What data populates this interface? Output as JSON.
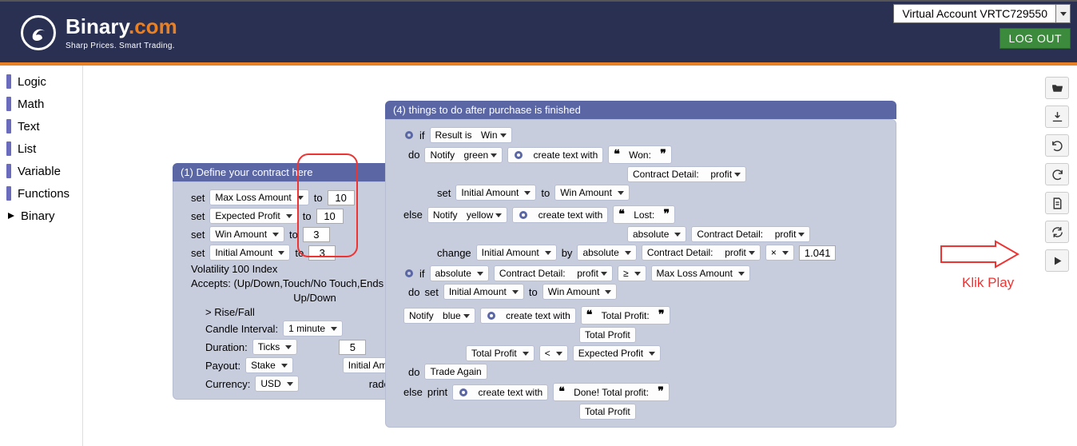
{
  "header": {
    "brand_main": "Binary",
    "brand_accent": ".com",
    "tagline": "Sharp Prices. Smart Trading.",
    "account": "Virtual Account VRTC729550",
    "logout": "LOG OUT"
  },
  "sidebar": {
    "items": [
      "Logic",
      "Math",
      "Text",
      "List",
      "Variable",
      "Functions",
      "Binary"
    ],
    "selected": "Binary"
  },
  "block1": {
    "title": "(1) Define your contract here",
    "set": "set",
    "to": "to",
    "vars": {
      "maxloss": "Max Loss Amount",
      "expected": "Expected Profit",
      "winamt": "Win Amount",
      "initamt": "Initial Amount"
    },
    "vals": {
      "maxloss": "10",
      "expected": "10",
      "winamt": "3",
      "initamt": "3"
    },
    "volatility": "Volatility 100 Index",
    "accepts": "Accepts: (Up/Down,Touch/No Touch,Ends In/Out,Sta...",
    "updown": "Up/Down",
    "risefall": "> Rise/Fall",
    "candle_lbl": "Candle Interval:",
    "candle_val": "1 minute",
    "duration_lbl": "Duration:",
    "duration_val": "Ticks",
    "duration_num": "5",
    "payout_lbl": "Payout:",
    "payout_val": "Stake",
    "payout_amt": "Initial Amount",
    "currency_lbl": "Currency:",
    "currency_val": "USD",
    "trade_tail": "rade"
  },
  "block4": {
    "title": "(4) things to do after purchase is finished",
    "if": "if",
    "do": "do",
    "else": "else",
    "result_is": "Result is",
    "win": "Win",
    "notify": "Notify",
    "green": "green",
    "yellow": "yellow",
    "blue": "blue",
    "create_text": "create text with",
    "won": "Won:",
    "lost": "Lost:",
    "contract_detail": "Contract Detail:",
    "profit": "profit",
    "set": "set",
    "to": "to",
    "initial_amount": "Initial Amount",
    "win_amount": "Win Amount",
    "change": "change",
    "by": "by",
    "absolute": "absolute",
    "mult": "×",
    "mult_val": "1.041",
    "gte": "≥",
    "maxloss": "Max Loss Amount",
    "total_profit": "Total Profit",
    "total_profit_lbl": "Total Profit:",
    "lt": "<",
    "expected": "Expected Profit",
    "trade_again": "Trade Again",
    "print": "print",
    "done": "Done! Total profit:"
  },
  "annotation": {
    "play": "Klik Play"
  },
  "toolbar": {
    "open": "folder-open-icon",
    "download": "download-icon",
    "undo": "undo-icon",
    "redo": "redo-icon",
    "doc": "doc-icon",
    "sync": "sync-icon",
    "play": "play-icon"
  }
}
